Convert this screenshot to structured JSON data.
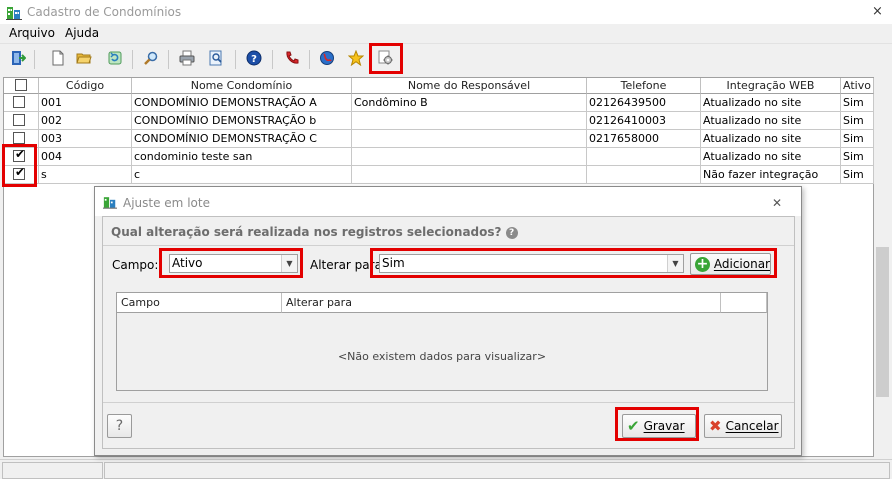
{
  "window": {
    "title": "Cadastro de Condomínios",
    "close": "×"
  },
  "menu": [
    "Arquivo",
    "Ajuda"
  ],
  "toolbar": [
    {
      "icon": "exit-icon"
    },
    {
      "icon": "new-document-icon"
    },
    {
      "icon": "open-folder-icon"
    },
    {
      "icon": "refresh-icon"
    },
    {
      "icon": "search-icon"
    },
    {
      "icon": "print-icon"
    },
    {
      "icon": "print-preview-icon"
    },
    {
      "icon": "help-icon"
    },
    {
      "icon": "phone-icon"
    },
    {
      "icon": "web-icon"
    },
    {
      "icon": "star-icon"
    },
    {
      "icon": "batch-settings-icon"
    }
  ],
  "grid": {
    "columns": [
      "",
      "Código",
      "Nome Condomínio",
      "Nome do Responsável",
      "Telefone",
      "Integração WEB",
      "Ativo"
    ],
    "rows": [
      {
        "checked": false,
        "codigo": "001",
        "nome": "CONDOMÍNIO DEMONSTRAÇÃO A",
        "responsavel": "Condômino B",
        "telefone": "02126439500",
        "integracao": "Atualizado no site",
        "ativo": "Sim"
      },
      {
        "checked": false,
        "codigo": "002",
        "nome": "CONDOMÍNIO DEMONSTRAÇÃO b",
        "responsavel": "",
        "telefone": "02126410003",
        "integracao": "Atualizado no site",
        "ativo": "Sim"
      },
      {
        "checked": false,
        "codigo": "003",
        "nome": "CONDOMÍNIO DEMONSTRAÇÃO C",
        "responsavel": "",
        "telefone": "0217658000",
        "integracao": "Atualizado no site",
        "ativo": "Sim"
      },
      {
        "checked": true,
        "codigo": "004",
        "nome": "condominio teste san",
        "responsavel": "",
        "telefone": "",
        "integracao": "Atualizado no site",
        "ativo": "Sim"
      },
      {
        "checked": true,
        "codigo": "s",
        "nome": "c",
        "responsavel": "",
        "telefone": "",
        "integracao": "Não fazer integração",
        "ativo": "Sim"
      }
    ]
  },
  "dialog": {
    "title": "Ajuste em lote",
    "close": "✕",
    "question": "Qual alteração será realizada nos registros selecionados?",
    "campo_label": "Campo:",
    "campo_value": "Ativo",
    "alterar_label": "Alterar para:",
    "alterar_value": "Sim",
    "add_button": "Adicionar",
    "subgrid_columns": [
      "Campo",
      "Alterar para"
    ],
    "empty_text": "<Não existem dados para visualizar>",
    "help_button": "?",
    "save_button": "Gravar",
    "cancel_button": "Cancelar"
  },
  "colors": {
    "highlight": "#e30000",
    "accent_green": "#3aa537",
    "cancel_red": "#d9412b"
  }
}
